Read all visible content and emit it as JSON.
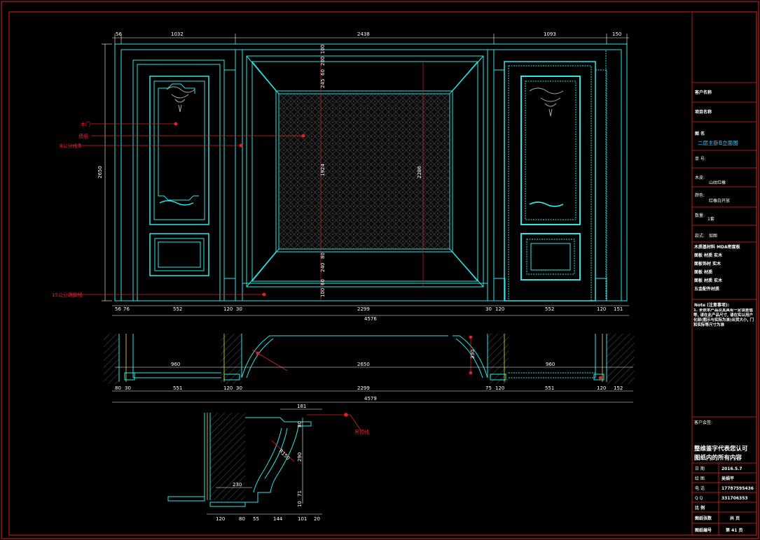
{
  "elevation": {
    "top_dims": [
      "56",
      "1032",
      "2438",
      "1093",
      "150"
    ],
    "bottom_dims": [
      "56",
      "76",
      "552",
      "120",
      "30",
      "2299",
      "30",
      "120",
      "552",
      "120",
      "151"
    ],
    "overall_width": "4576",
    "height_left": "2650",
    "height_mid": "2286",
    "vertical_stack": [
      "100",
      "200",
      "60",
      "245",
      "1924",
      "80",
      "240",
      "60",
      "100"
    ],
    "callouts": [
      "木门",
      "墙纸",
      "8公分线条",
      "15公分踢脚线"
    ]
  },
  "section": {
    "dims_upper": [
      "960",
      "2650",
      "960",
      "330"
    ],
    "dims_lower": [
      "80",
      "30",
      "551",
      "120",
      "30",
      "2299",
      "75",
      "120",
      "551",
      "120",
      "152"
    ],
    "overall_width": "4579"
  },
  "detail": {
    "dims_top": [
      "181"
    ],
    "dims_side": [
      "80",
      "290",
      "71",
      "10"
    ],
    "dims_radius": "R150",
    "dims_left": [
      "230"
    ],
    "dims_bottom": [
      "120",
      "80",
      "55",
      "144",
      "101",
      "20"
    ],
    "callout": "吊顶线"
  },
  "title_block": {
    "customer_label": "客户名称",
    "project_label": "项目名称",
    "drawing_name_label": "图 名",
    "drawing_name": "二层主卧B立面图",
    "order_label": "单 号:",
    "wood_label": "木皮:",
    "wood_value": "山纹红橡",
    "color_label": "颜色:",
    "color_value": "红橡白开放",
    "quantity_label": "数量:",
    "quantity_value": "1套",
    "style_label": "款式:",
    "style_value": "如图",
    "materials": [
      "木质基材料  MDA密度板",
      "面板  材质  实木",
      "面板饰材  实木",
      "面板  材质",
      "面板  材质  实木",
      "五金配件材质"
    ],
    "note_title": "Note (注意事项):",
    "note_body": "1. 未依本产品及其具有一定误差值等, 请在此产品尺寸, 请在实以用户化部(图示与实际为准)出货大小, 门和实际等尺寸为准",
    "client_sign_label": "客户会签:",
    "company_line1": "整维鉴字代表您认可",
    "company_line2": "图纸内的所有内容",
    "rows": [
      {
        "k": "日    期",
        "v": "2016.5.7"
      },
      {
        "k": "绘    图",
        "v": "吴娟平"
      },
      {
        "k": "电    话",
        "v": "17787595436"
      },
      {
        "k": "Q    Q",
        "v": "331706353"
      },
      {
        "k": "比    例",
        "v": ""
      },
      {
        "k": "图纸张数",
        "v": "共   页"
      },
      {
        "k": "图纸编号",
        "v": "第 41 页"
      }
    ],
    "page_number": "41"
  },
  "colors": {
    "background": "#000000",
    "frame": "#e02020",
    "geometry": "#29e6e6",
    "dimension": "#ffffff",
    "callout": "#e02020",
    "hatch": "#9a9a9a",
    "yellow": "#e6e620"
  }
}
